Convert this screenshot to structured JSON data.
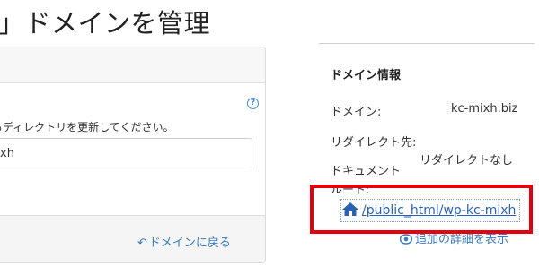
{
  "header": {
    "title": "」ドメインを管理"
  },
  "form": {
    "help_icon": "?",
    "help_text": "るディレクトリを更新してください。",
    "input_value": "xh",
    "back_label": "ドメインに戻る"
  },
  "info": {
    "heading": "ドメイン情報",
    "domain_label": "ドメイン:",
    "domain_value": "kc-mixh.biz",
    "redirect_label": "リダイレクト先:",
    "redirect_value": "リダイレクトなし",
    "docroot_label_1": "ドキュメント",
    "docroot_label_2": "ルート:",
    "docroot_link": "/public_html/wp-kc-mixh",
    "more_details": "追加の詳細を表示"
  },
  "icons": {
    "help": "question-circle-icon",
    "back": "back-arrow-icon",
    "home": "home-icon",
    "eye": "eye-icon"
  },
  "colors": {
    "link": "#3a7bbf",
    "highlight": "#e2000f",
    "help_icon": "#3f8ed1"
  }
}
